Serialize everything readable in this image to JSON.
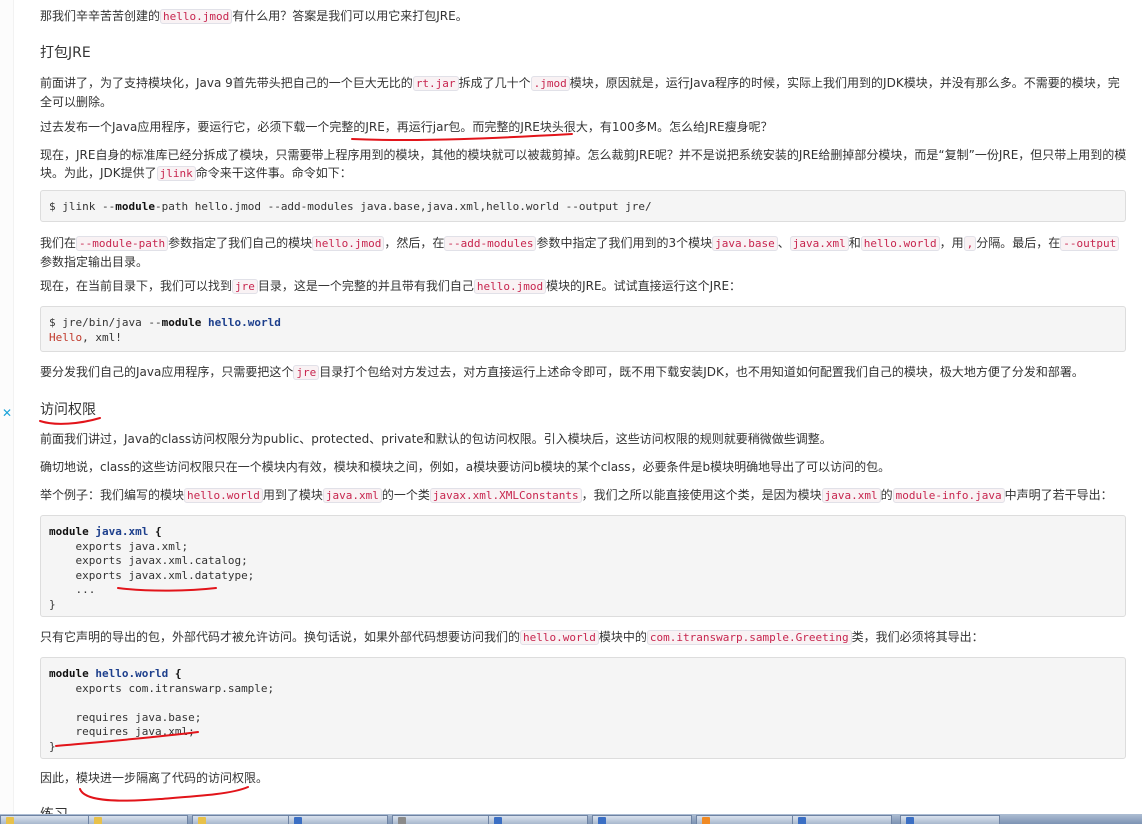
{
  "article": {
    "p1": {
      "t0": "那我们辛辛苦苦创建的",
      "c0": "hello.jmod",
      "t1": "有什么用？答案是我们可以用它来打包JRE。"
    },
    "h_pack": "打包JRE",
    "p2": {
      "t0": "前面讲了，为了支持模块化，Java 9首先带头把自己的一个巨大无比的",
      "c0": "rt.jar",
      "t1": "拆成了几十个",
      "c1": ".jmod",
      "t2": "模块，原因就是，运行Java程序的时候，实际上我们用到的JDK模块，并没有那么多。不需要的模块，完全可以删除。"
    },
    "p3": "过去发布一个Java应用程序，要运行它，必须下载一个完整的JRE，再运行jar包。而完整的JRE块头很大，有100多M。怎么给JRE瘦身呢？",
    "p4": {
      "t0": "现在，JRE自身的标准库已经分拆成了模块，只需要带上程序用到的模块，其他的模块就可以被裁剪掉。怎么裁剪JRE呢？并不是说把系统安装的JRE给删掉部分模块，而是“复制”一份JRE，但只带上用到的模块。为此，JDK提供了",
      "c0": "jlink",
      "t1": "命令来干这件事。命令如下："
    },
    "code1": {
      "prompt": "$ jlink --",
      "kw": "module",
      "rest": "-path hello.jmod --add-modules java.base,java.xml,hello.world --output jre/"
    },
    "p5": {
      "t0": "我们在",
      "c0": "--module-path",
      "t1": "参数指定了我们自己的模块",
      "c1": "hello.jmod",
      "t2": "，然后，在",
      "c2": "--add-modules",
      "t3": "参数中指定了我们用到的3个模块",
      "c3": "java.base",
      "t4": "、",
      "c4": "java.xml",
      "t5": "和",
      "c5": "hello.world",
      "t6": "，用",
      "c6": ",",
      "t7": "分隔。最后，在",
      "c7": "--output",
      "t8": "参数指定输出目录。"
    },
    "p6": {
      "t0": "现在，在当前目录下，我们可以找到",
      "c0": "jre",
      "t1": "目录，这是一个完整的并且带有我们自己",
      "c1": "hello.jmod",
      "t2": "模块的JRE。试试直接运行这个JRE："
    },
    "code2": {
      "prompt": "$ jre/bin/java --",
      "kw": "module",
      "name": "hello.world",
      "out1": "Hello",
      "out2": ", xml!"
    },
    "p7": {
      "t0": "要分发我们自己的Java应用程序，只需要把这个",
      "c0": "jre",
      "t1": "目录打个包给对方发过去，对方直接运行上述命令即可，既不用下载安装JDK，也不用知道如何配置我们自己的模块，极大地方便了分发和部署。"
    },
    "h_access": "访问权限",
    "p8": "前面我们讲过，Java的class访问权限分为public、protected、private和默认的包访问权限。引入模块后，这些访问权限的规则就要稍微做些调整。",
    "p9": "确切地说，class的这些访问权限只在一个模块内有效，模块和模块之间，例如，a模块要访问b模块的某个class，必要条件是b模块明确地导出了可以访问的包。",
    "p10": {
      "t0": "举个例子：我们编写的模块",
      "c0": "hello.world",
      "t1": "用到了模块",
      "c1": "java.xml",
      "t2": "的一个类",
      "c2": "javax.xml.XMLConstants",
      "t3": "，我们之所以能直接使用这个类，是因为模块",
      "c3": "java.xml",
      "t4": "的",
      "c4": "module-info.java",
      "t5": "中声明了若干导出："
    },
    "code3": {
      "kw": "module",
      "name": "java.xml",
      "open": "{",
      "l1": "exports java.xml;",
      "l2": "exports javax.xml.catalog;",
      "l3": "exports javax.xml.datatype;",
      "l4": "...",
      "close": "}"
    },
    "p11": {
      "t0": "只有它声明的导出的包，外部代码才被允许访问。换句话说，如果外部代码想要访问我们的",
      "c0": "hello.world",
      "t1": "模块中的",
      "c1": "com.itranswarp.sample.Greeting",
      "t2": "类，我们必须将其导出："
    },
    "code4": {
      "kw": "module",
      "name": "hello.world",
      "open": "{",
      "l1": "exports com.itranswarp.sample;",
      "l2": "requires java.base;",
      "l3": "requires java.xml;",
      "close": "}"
    },
    "p12": "因此，模块进一步隔离了代码的访问权限。",
    "h_next": "练习"
  },
  "gutter_icon": "close-icon",
  "annotation_color": "#e2141a",
  "taskbar": {
    "icons": [
      "folder-icon",
      "folder-icon",
      "folder-icon",
      "app-icon",
      "document-icon",
      "app-icon",
      "app-icon",
      "browser-icon",
      "app-icon",
      "app-icon"
    ]
  }
}
